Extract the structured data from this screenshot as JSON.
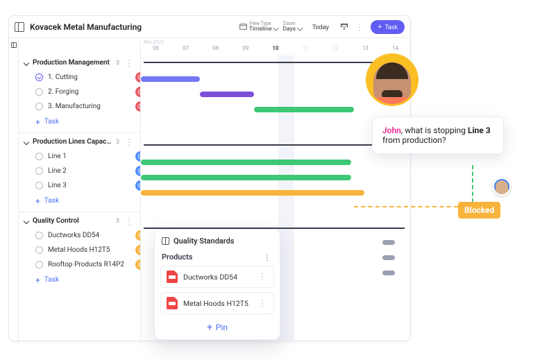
{
  "title": "Kovacek Metal Manufacturing",
  "toolbar": {
    "view_type_label": "View Type",
    "view_type_value": "Timeline",
    "zoom_label": "Zoom",
    "zoom_value": "Days",
    "today": "Today",
    "new_task": "Task"
  },
  "timeline": {
    "month_label": "Mw 2023",
    "days": [
      "06",
      "07",
      "08",
      "09",
      "10",
      "11",
      "12",
      "13",
      "14"
    ]
  },
  "sidebar": {
    "add_task": "Task",
    "sections": [
      {
        "name": "Production Management",
        "count": "3",
        "tasks": [
          {
            "label": "1. Cutting",
            "done": true,
            "avatar": "c1"
          },
          {
            "label": "2. Forging",
            "done": false,
            "avatar": "c1"
          },
          {
            "label": "3. Manufacturing",
            "done": false,
            "avatar": "c1"
          }
        ]
      },
      {
        "name": "Production Lines Capacity",
        "count": "3",
        "tasks": [
          {
            "label": "Line 1",
            "done": false,
            "avatar": "c2"
          },
          {
            "label": "Line 2",
            "done": false,
            "avatar": "c2"
          },
          {
            "label": "Line 3",
            "done": false,
            "avatar": "c2"
          }
        ]
      },
      {
        "name": "Quality Control",
        "count": "3",
        "tasks": [
          {
            "label": "Ductworks DD54",
            "done": false,
            "avatar": "c3"
          },
          {
            "label": "Metal Hoods H12T5",
            "done": false,
            "avatar": "c3"
          },
          {
            "label": "Rooftop Products R14P2",
            "done": false,
            "avatar": "c3"
          }
        ]
      }
    ]
  },
  "comment": {
    "who": "John",
    "rest_1": ", what is stopping ",
    "bold": "Line 3",
    "rest_2": " from production?"
  },
  "blocked_label": "Blocked",
  "qs": {
    "title": "Quality Standards",
    "subtitle": "Products",
    "item1": "Ductworks DD54",
    "item2": "Metal Hoods H12T5",
    "pin": "Pin"
  }
}
